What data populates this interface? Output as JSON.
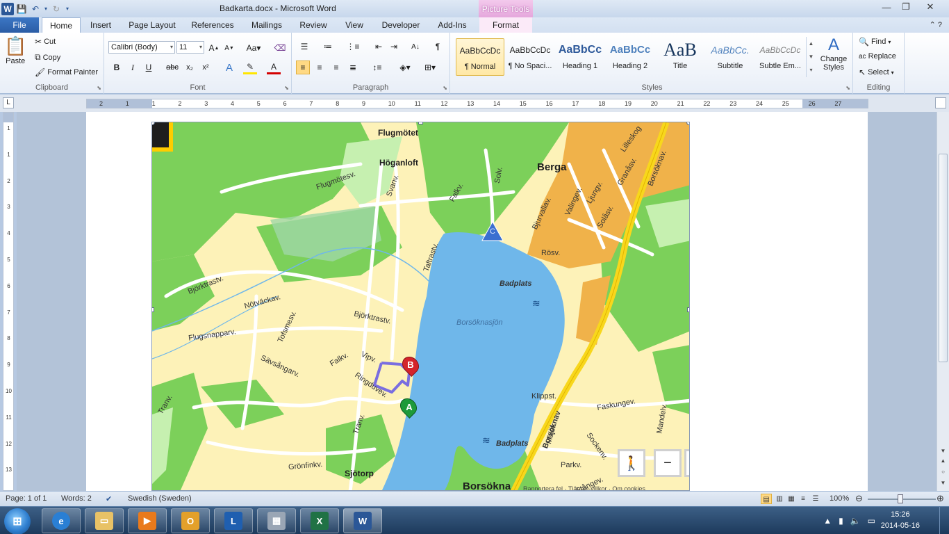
{
  "titlebar": {
    "doc_title": "Badkarta.docx - Microsoft Word",
    "contextual_tab": "Picture Tools"
  },
  "tabs": {
    "file": "File",
    "items": [
      "Home",
      "Insert",
      "Page Layout",
      "References",
      "Mailings",
      "Review",
      "View",
      "Developer",
      "Add-Ins",
      "Format"
    ],
    "active": "Home"
  },
  "ribbon": {
    "clipboard": {
      "label": "Clipboard",
      "paste": "Paste",
      "cut": "Cut",
      "copy": "Copy",
      "format_painter": "Format Painter"
    },
    "font": {
      "label": "Font",
      "font_name": "Calibri (Body)",
      "font_size": "11"
    },
    "paragraph": {
      "label": "Paragraph"
    },
    "styles": {
      "label": "Styles",
      "items": [
        {
          "sample": "AaBbCcDc",
          "name": "¶ Normal"
        },
        {
          "sample": "AaBbCcDc",
          "name": "¶ No Spaci..."
        },
        {
          "sample": "AaBbCc",
          "name": "Heading 1"
        },
        {
          "sample": "AaBbCc",
          "name": "Heading 2"
        },
        {
          "sample": "AaB",
          "name": "Title"
        },
        {
          "sample": "AaBbCc.",
          "name": "Subtitle"
        },
        {
          "sample": "AaBbCcDc",
          "name": "Subtle Em..."
        }
      ],
      "change_styles": "Change Styles"
    },
    "editing": {
      "label": "Editing",
      "find": "Find",
      "replace": "Replace",
      "select": "Select"
    }
  },
  "ruler": {
    "h_ticks": [
      "2",
      "1",
      "1",
      "2",
      "3",
      "4",
      "5",
      "6",
      "7",
      "8",
      "9",
      "10",
      "11",
      "12",
      "13",
      "14",
      "15",
      "16",
      "17",
      "18",
      "19",
      "20",
      "21",
      "22",
      "23",
      "24",
      "25",
      "26",
      "27"
    ],
    "v_ticks": [
      "1",
      "1",
      "2",
      "3",
      "4",
      "5",
      "6",
      "7",
      "8",
      "9",
      "10",
      "11",
      "12",
      "13",
      "14"
    ]
  },
  "map": {
    "labels": {
      "flugmotet": "Flugmötet",
      "hoganloft": "Höganloft",
      "berga": "Berga",
      "badplats_top": "Badplats",
      "borsoknasjon": "Borsöknasjön",
      "badplats_bottom": "Badplats",
      "sjotorp": "Sjötorp",
      "borsokna": "Borsökna",
      "flugmotesv": "Flugmötesv.",
      "svanv": "Svanv.",
      "falkv_top": "Falkv.",
      "solv": "Solv.",
      "bjurvallav": "Bjurvallav.",
      "valingev": "Valingev.",
      "ljungv": "Ljungv.",
      "granasv": "Granåsv.",
      "borsoknav_top": "Borsöknav.",
      "lilleskog": "Lilleskog",
      "solasv": "Solåsv.",
      "rosv": "Rösv.",
      "taltrastv": "Taltrastv.",
      "bjorktrastv_left": "Björktrastv.",
      "notvackav": "Nötväckav.",
      "bjorktrastv_mid": "Björktrastv.",
      "flugsnapparv": "Flugsnapparv.",
      "tofsmesv": "Tofsmesv.",
      "savsangarv": "Sävsångarv.",
      "falkv_mid": "Falkv.",
      "vipv": "Vipv.",
      "ringduvev": "Ringduvev.",
      "tranv": "Tranv.",
      "tranv_left": "Tranv.",
      "gronfinkv": "Grönfinkv.",
      "klippst": "Klippst.",
      "faskungev": "Faskungev.",
      "mandelv": "Mandelv.",
      "majst": "Majst.",
      "sockenv": "Sockenv.",
      "parkv": "Parkv.",
      "borsoknav_bottom": "Borsöknav",
      "stangev": "Stångev.",
      "attribution": "Rapportera fel · Tjänste-villkor · Om cookies"
    },
    "marker_a": "A",
    "marker_b": "B",
    "marker_c": "C",
    "zoom_out": "−"
  },
  "statusbar": {
    "page": "Page: 1 of 1",
    "words": "Words: 2",
    "language": "Swedish (Sweden)",
    "zoom": "100%"
  },
  "taskbar": {
    "time": "15:26",
    "date": "2014-05-16"
  },
  "colors": {
    "accent": "#2b5797",
    "water": "#6fb7ea",
    "park": "#7cd05a",
    "residential": "#fdf2b8",
    "dense": "#f0b24a",
    "marker_a": "#1e9a3a",
    "marker_b": "#d4242a",
    "route": "#7a6ee0"
  }
}
